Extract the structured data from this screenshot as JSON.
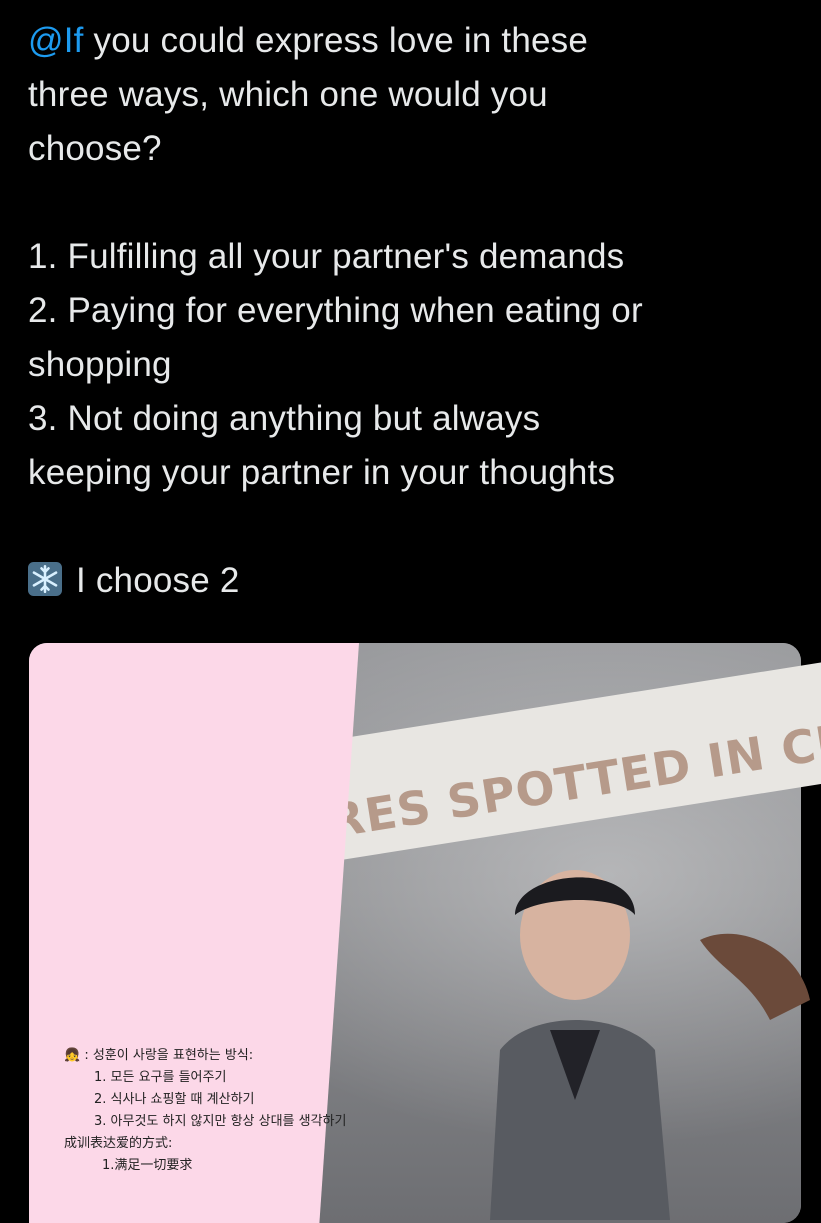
{
  "tweet": {
    "mention": "@If",
    "line1_rest": " you could express love in these",
    "line2": "three ways, which one would you",
    "line3": "choose?",
    "option1": "1. Fulfilling all your partner's demands",
    "option2a": "2. Paying for everything when eating or",
    "option2b": "shopping",
    "option3a": "3. Not doing anything but always",
    "option3b": "keeping your partner in your thoughts",
    "choice": "I choose 2",
    "choice_icon": "snowflake-icon"
  },
  "media": {
    "banner_text": "RES SPOTTED IN CIT",
    "overlay": {
      "ko_title": "성훈이 사랑을 표현하는 방식:",
      "ko_items": [
        "1.  모든 요구를 들어주기",
        "2.  식사나 쇼핑할 때 계산하기",
        "3.  아무것도 하지 않지만 항상 상대를 생각하기"
      ],
      "zh_title": "成训表达爱的方式:",
      "zh_item1": "1.满足一切要求"
    },
    "panel_color": "#fcd8e8"
  },
  "colors": {
    "background": "#000000",
    "text": "#e7e9ea",
    "mention": "#1d9bf0"
  }
}
